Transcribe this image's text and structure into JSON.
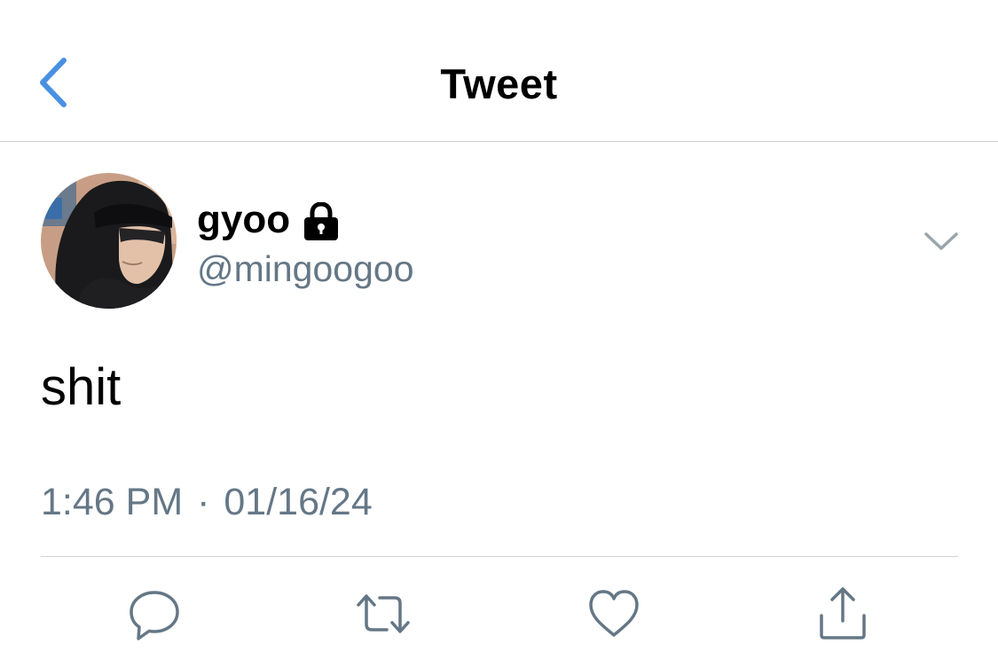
{
  "header": {
    "title": "Tweet",
    "back_icon": "chevron-left-icon",
    "accent_color": "#4a90e2"
  },
  "tweet": {
    "author": {
      "display_name": "gyoo",
      "protected_icon": "lock-icon",
      "handle": "@mingoogoo",
      "avatar": "avatar-photo"
    },
    "more_icon": "chevron-down-icon",
    "text": "shit",
    "time": "1:46 PM",
    "separator": "·",
    "date": "01/16/24"
  },
  "actions": [
    {
      "name": "reply",
      "icon": "reply-icon"
    },
    {
      "name": "retweet",
      "icon": "retweet-icon"
    },
    {
      "name": "like",
      "icon": "heart-icon"
    },
    {
      "name": "share",
      "icon": "share-icon"
    }
  ],
  "colors": {
    "secondary_text": "#657786",
    "icon_gray": "#657786",
    "divider": "#cfd3d6"
  }
}
